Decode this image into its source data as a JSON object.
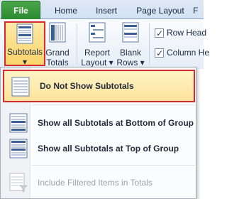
{
  "tabs": {
    "file": "File",
    "home": "Home",
    "insert": "Insert",
    "page_layout": "Page Layout",
    "partial": "F"
  },
  "ribbon": {
    "subtotals": "Subtotals",
    "grand_line1": "Grand",
    "grand_line2": "Totals",
    "report_line1": "Report",
    "report_line2": "Layout",
    "blank_line1": "Blank",
    "blank_line2": "Rows",
    "row_headers": "Row Head",
    "column_headers": "Column He"
  },
  "menu": {
    "items": [
      {
        "label": "Do Not Show Subtotals",
        "selected": true
      },
      {
        "label": "Show all Subtotals at Bottom of Group"
      },
      {
        "label": "Show all Subtotals at Top of Group"
      },
      {
        "label": "Include Filtered Items in Totals",
        "disabled": true
      }
    ]
  },
  "colors": {
    "file_tab": "#2a8a30",
    "highlight_border": "#d62a33",
    "hover_fill": "#fde39b",
    "ribbon_bg": "#e5edf7"
  }
}
